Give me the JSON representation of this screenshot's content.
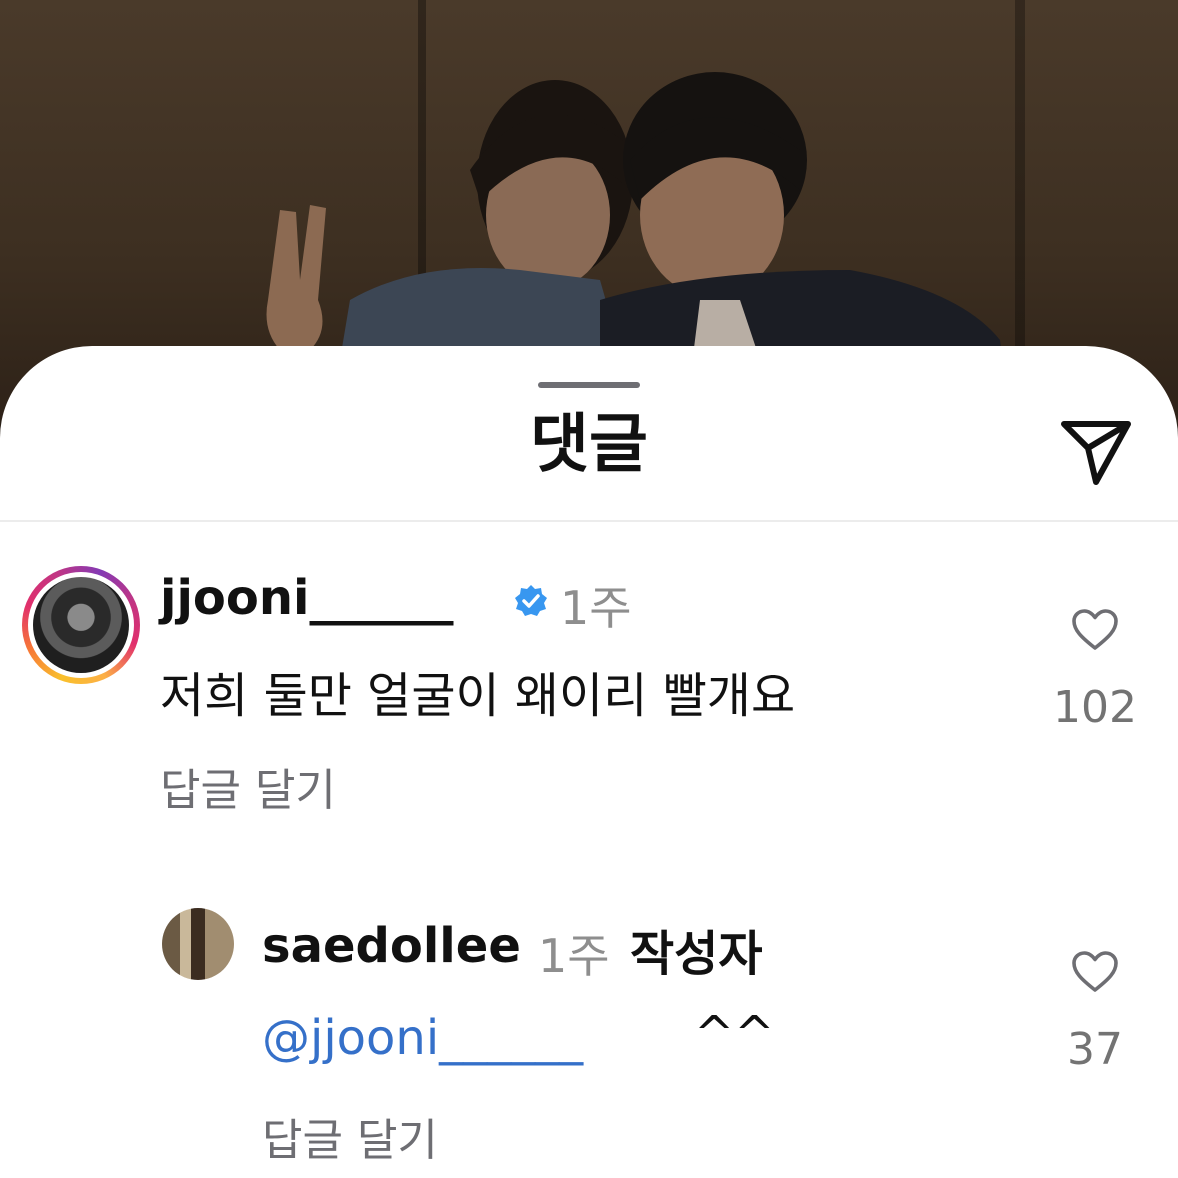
{
  "sheet": {
    "title": "댓글",
    "share_icon": "paper-plane-icon"
  },
  "comments": [
    {
      "username": "jjooni______",
      "verified": true,
      "time": "1주",
      "text": "저희 둘만 얼굴이 왜이리 빨개요",
      "reply_label": "답글 달기",
      "likes": "102"
    },
    {
      "username": "saedollee",
      "time": "1주",
      "author_badge": "작성자",
      "mention": "@jjooni______",
      "text": "^^",
      "reply_label": "답글 달기",
      "likes": "37"
    }
  ],
  "colors": {
    "mention": "#3570c9",
    "verified": "#3897f0",
    "muted": "#8e8e8e"
  }
}
